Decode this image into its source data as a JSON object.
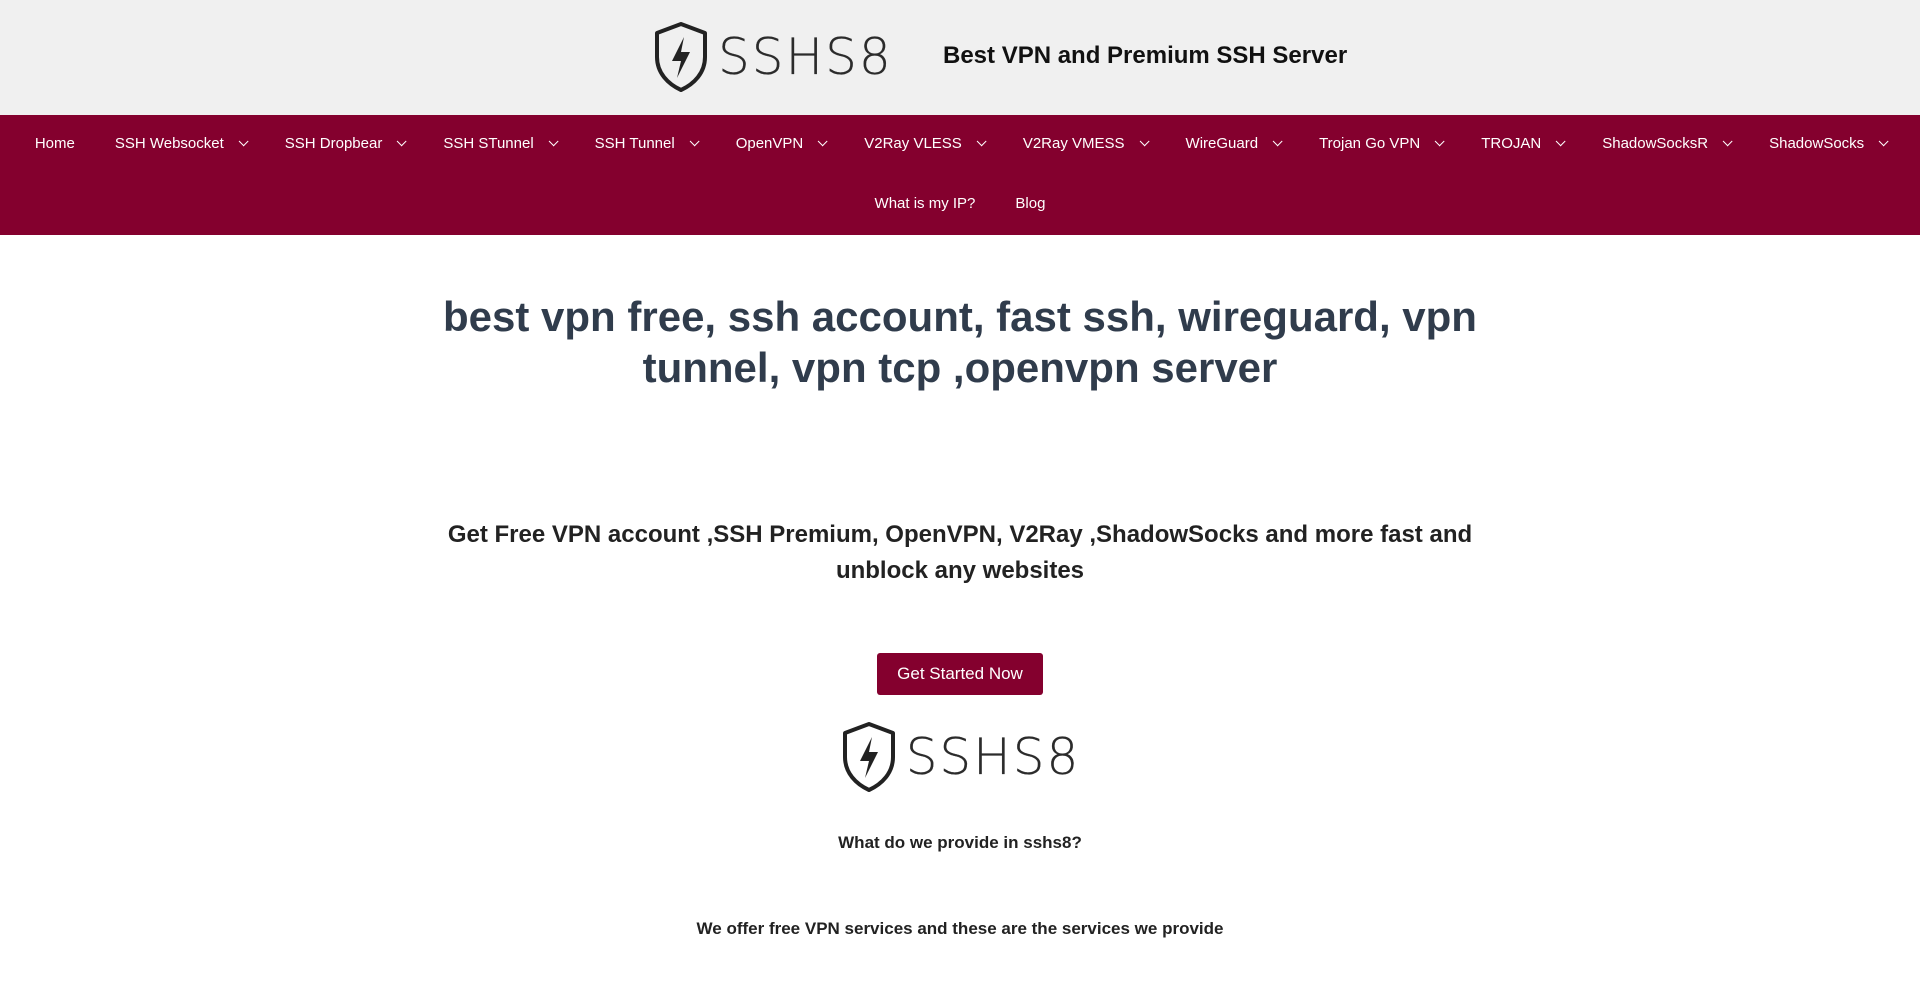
{
  "header": {
    "logo_text": "SSHS8",
    "tagline": "Best VPN and Premium SSH Server"
  },
  "nav": {
    "row1": [
      {
        "label": "Home",
        "dropdown": false
      },
      {
        "label": "SSH Websocket",
        "dropdown": true
      },
      {
        "label": "SSH Dropbear",
        "dropdown": true
      },
      {
        "label": "SSH STunnel",
        "dropdown": true
      },
      {
        "label": "SSH Tunnel",
        "dropdown": true
      },
      {
        "label": "OpenVPN",
        "dropdown": true
      },
      {
        "label": "V2Ray VLESS",
        "dropdown": true
      },
      {
        "label": "V2Ray VMESS",
        "dropdown": true
      },
      {
        "label": "WireGuard",
        "dropdown": true
      },
      {
        "label": "Trojan Go VPN",
        "dropdown": true
      },
      {
        "label": "TROJAN",
        "dropdown": true
      },
      {
        "label": "ShadowSocksR",
        "dropdown": true
      },
      {
        "label": "ShadowSocks",
        "dropdown": true
      }
    ],
    "row2": [
      {
        "label": "What is my IP?",
        "dropdown": false
      },
      {
        "label": "Blog",
        "dropdown": false
      }
    ]
  },
  "main": {
    "title": "best vpn free, ssh account, fast ssh, wireguard, vpn tunnel, vpn tcp ,openvpn server",
    "subtitle": "Get Free VPN account ,SSH Premium, OpenVPN, V2Ray ,ShadowSocks and more fast and unblock any websites",
    "cta_label": "Get Started Now",
    "logo_text": "SSHS8",
    "question": "What do we provide in sshs8?",
    "offer": "We offer free VPN services and these are the services we provide"
  },
  "colors": {
    "brand": "#84002e",
    "header_bg": "#f0f0f0",
    "title": "#303c4c"
  },
  "icons": [
    "shield-bolt-icon",
    "chevron-down-icon"
  ]
}
